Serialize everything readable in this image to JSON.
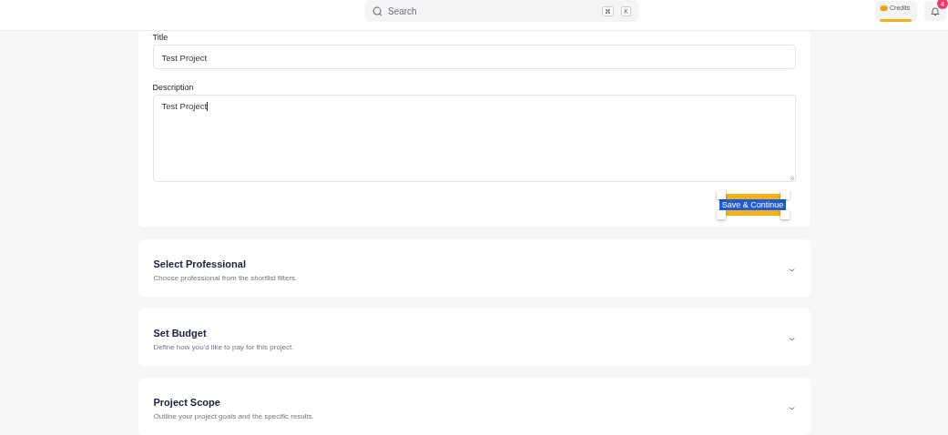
{
  "header": {
    "search": {
      "placeholder": "Search",
      "shortcut": [
        "⌘",
        "K"
      ]
    },
    "credits": {
      "label": "Credits"
    },
    "notifications": {
      "count": "4"
    }
  },
  "form": {
    "fields": [
      {
        "kind": "input",
        "label": "Title",
        "value": "Test Project"
      },
      {
        "kind": "textarea",
        "label": "Description",
        "value": "Test Project"
      }
    ],
    "button": {
      "label": "Save & Continue",
      "selected": true
    }
  },
  "sections": [
    {
      "title": "Select Professional",
      "description": "Choose professional from the shortlist filters.",
      "expanded": false
    },
    {
      "title": "Set Budget",
      "description": "Define how you'd like to pay for this project.",
      "expanded": false
    },
    {
      "title": "Project Scope",
      "description": "Outline your project goals and the specific results.",
      "expanded": false
    }
  ]
}
